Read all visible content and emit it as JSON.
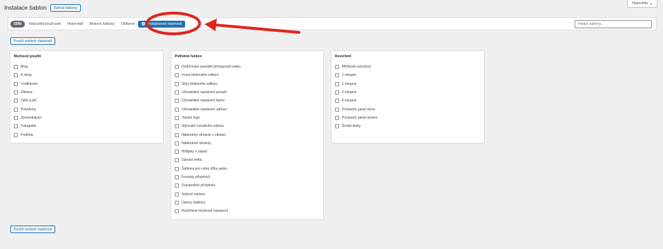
{
  "header": {
    "title": "Instalace šablon",
    "upload_label": "Nahrát šablonu",
    "help_label": "Nápověda",
    "help_icon": "▼"
  },
  "filter": {
    "count": "5580",
    "tabs": [
      "Nejčastěji používané",
      "Nejnovější",
      "Blokové šablony",
      "Oblíbené"
    ],
    "active_tab": "Požadované vlastnosti",
    "search_placeholder": "Hledat šablony..."
  },
  "apply_label": "Použít zvolené vlastnosti",
  "panels": {
    "subject": {
      "title": "Možnosti použití",
      "items": [
        "Blog",
        "E-shop",
        "Vzdělávání",
        "Zábava",
        "Jídlo a pití",
        "Prázdniny",
        "Zpravodajství",
        "Fotografie",
        "Portfolio"
      ]
    },
    "features": {
      "title": "Potřebné funkce",
      "items": [
        "Dodržování pravidel přístupnosti webu",
        "Vzory blokového editoru",
        "Styly blokového editoru",
        "Uživatelské nastavení pozadí",
        "Uživatelské nastavení barev",
        "Uživatelské nastavení záhlaví",
        "Vlastní logo",
        "Stylování vizuálního editoru",
        "Náhledový obrázek v záhlaví",
        "Náhledové obrázky",
        "Widgety v zápatí",
        "Úprava webu",
        "Šablona pro celou šířku webu",
        "Formáty příspěvků",
        "Zvýrazněné příspěvky",
        "Stylové variace",
        "Úpravy šablony",
        "Rozšířené možnosti nastavení"
      ]
    },
    "layout": {
      "title": "Rozvržení",
      "items": [
        "Mřížkové rozvržení",
        "1 sloupec",
        "2 sloupce",
        "3 sloupce",
        "4 sloupce",
        "Postranní panel vlevo",
        "Postranní panel vpravo",
        "Široké bloky"
      ]
    }
  },
  "colors": {
    "accent": "#2271b1",
    "annotation": "#e0241b",
    "background": "#f0f0f1"
  }
}
